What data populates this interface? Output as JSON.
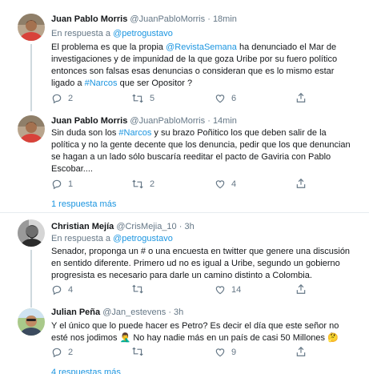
{
  "tweets": [
    {
      "name": "Juan Pablo Morris",
      "handle": "@JuanPabloMorris",
      "sep": "·",
      "time": "18min",
      "reply_prefix": "En respuesta a",
      "reply_to": "@petrogustavo",
      "body": [
        [
          [
            "t",
            "El problema es que la propia "
          ],
          [
            "l",
            "@RevistaSemana"
          ],
          [
            "t",
            " ha denunciado el Mar de"
          ]
        ],
        [
          [
            "t",
            "investigaciones y de impunidad de la que goza Uribe por su fuero político"
          ]
        ],
        [
          [
            "t",
            "entonces son falsas esas denuncias o consideran que es lo mismo estar"
          ]
        ],
        [
          [
            "t",
            "ligado a "
          ],
          [
            "l",
            "#Narcos"
          ],
          [
            "t",
            " que ser Opositor ?"
          ]
        ]
      ],
      "replies": "2",
      "retweets": "5",
      "likes": "6",
      "avatar": "avatar-man-red-shirt"
    },
    {
      "name": "Juan Pablo Morris",
      "handle": "@JuanPabloMorris",
      "sep": "·",
      "time": "14min",
      "body": [
        [
          [
            "t",
            "Sin duda son los "
          ],
          [
            "l",
            "#Narcos"
          ],
          [
            "t",
            " y su brazo Poñitico los que deben salir de la"
          ]
        ],
        [
          [
            "t",
            "política y no la gente decente que los denuncia, pedir que los que denuncian"
          ]
        ],
        [
          [
            "t",
            "se hagan a un lado sólo buscaría reeditar el pacto de Gaviria con Pablo"
          ]
        ],
        [
          [
            "t",
            "Escobar...."
          ]
        ]
      ],
      "replies": "1",
      "retweets": "2",
      "likes": "4",
      "avatar": "avatar-man-red-shirt"
    },
    {
      "name": "Christian Mejía",
      "handle": "@CrisMejia_10",
      "sep": "·",
      "time": "3h",
      "reply_prefix": "En respuesta a",
      "reply_to": "@petrogustavo",
      "body": [
        [
          [
            "t",
            "Senador, proponga un # o una encuesta en twitter que genere una discusión"
          ]
        ],
        [
          [
            "t",
            "en sentido diferente. Primero ud no es igual a Uribe, segundo un gobierno"
          ]
        ],
        [
          [
            "t",
            "progresista es necesario para darle un camino distinto a Colombia."
          ]
        ]
      ],
      "replies": "4",
      "retweets": "",
      "likes": "14",
      "avatar": "avatar-bearded-man-bw"
    },
    {
      "name": "Julian Peña",
      "handle": "@Jan_estevens",
      "sep": "·",
      "time": "3h",
      "body": [
        [
          [
            "t",
            "Y el único que lo puede hacer es Petro? Es decir el día que este señor no"
          ]
        ],
        [
          [
            "t",
            "esté nos jodimos 🤦‍♂️  No hay nadie más en un país de casi 50 Millones 🤔"
          ]
        ]
      ],
      "replies": "2",
      "retweets": "",
      "likes": "9",
      "avatar": "avatar-man-outdoors"
    }
  ],
  "show_more": [
    "1 respuesta más",
    "4 respuestas más"
  ],
  "colors": {
    "link": "#1b95e0",
    "muted": "#657786",
    "text": "#14171a",
    "thread_line": "#cfd9de",
    "divider": "#e6ecf0"
  },
  "icons": [
    "reply-icon",
    "retweet-icon",
    "like-icon",
    "share-icon"
  ]
}
